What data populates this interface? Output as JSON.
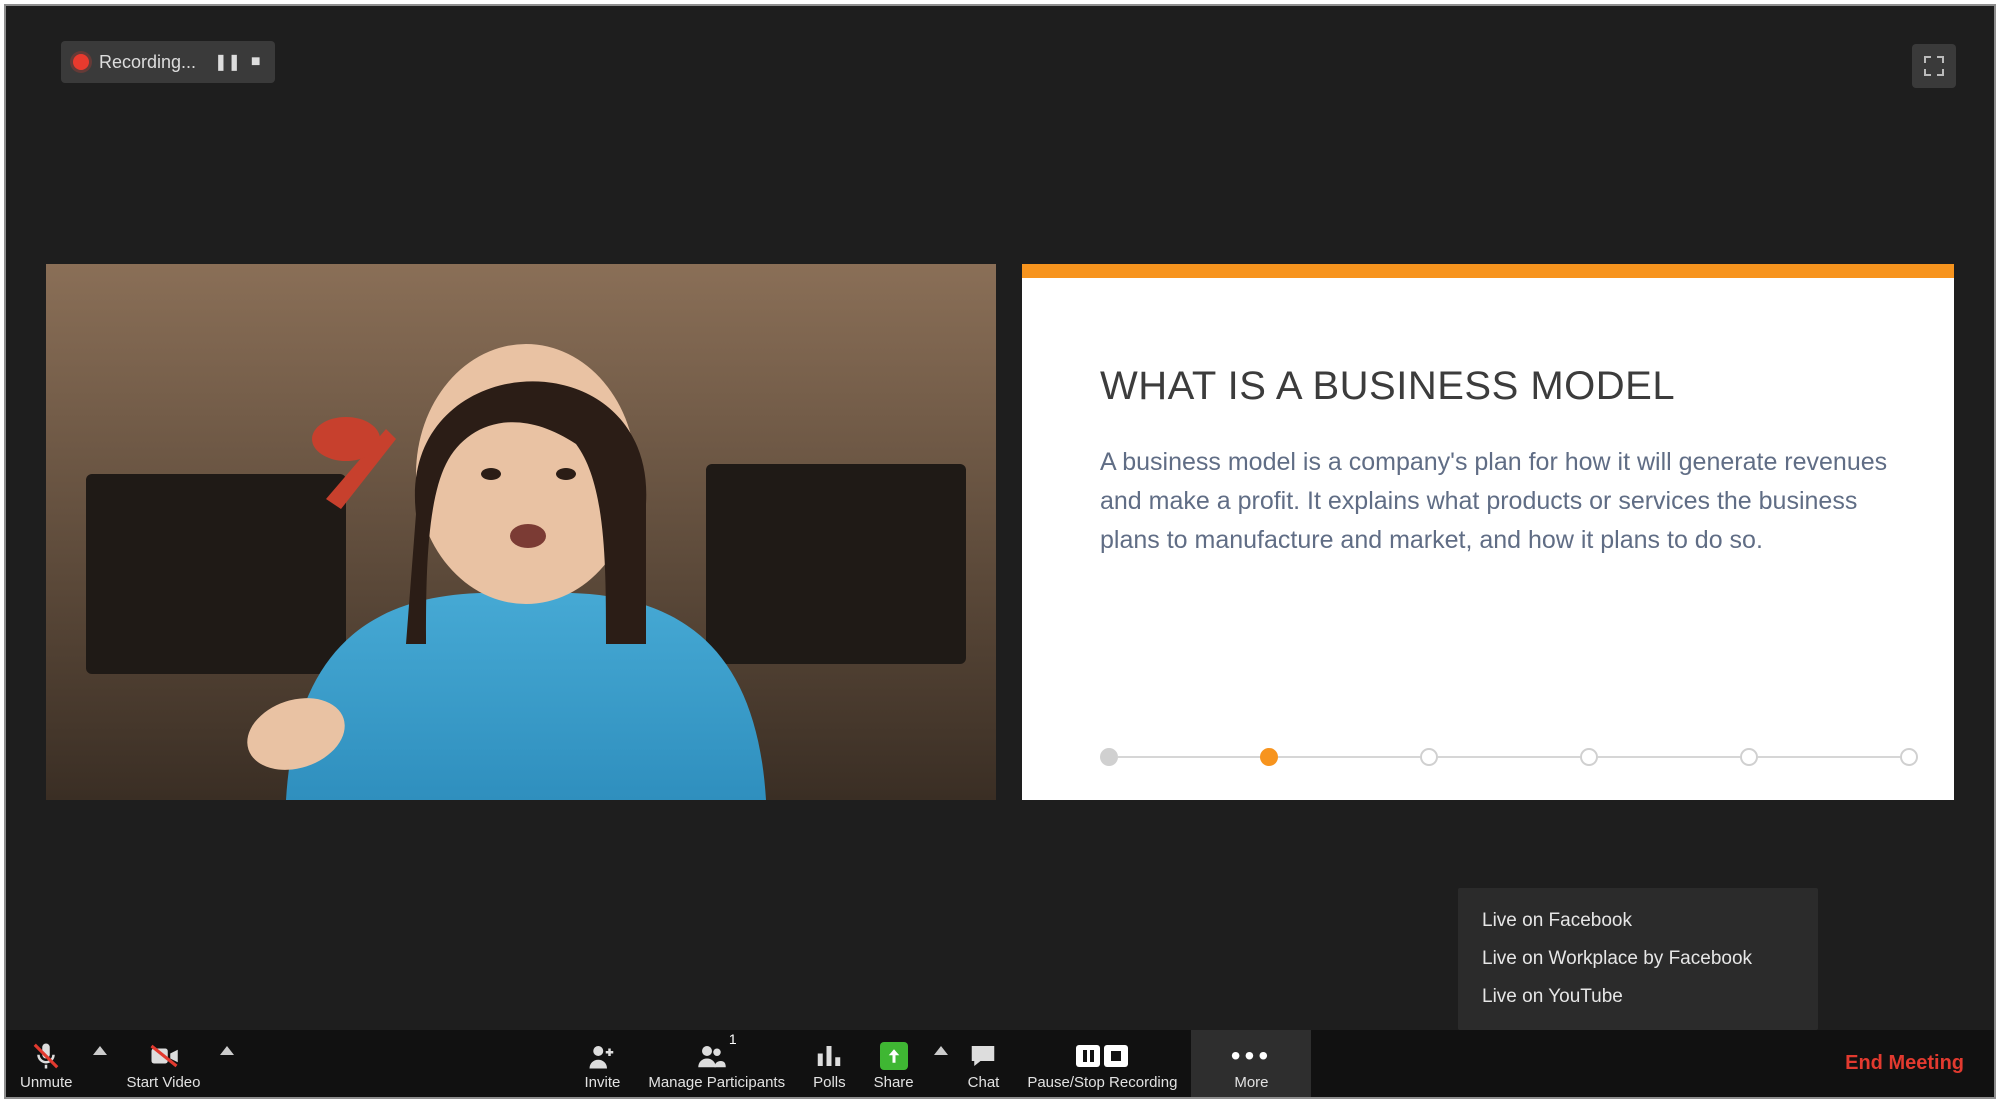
{
  "recording": {
    "label": "Recording...",
    "pause_glyph": "❚❚",
    "stop_glyph": "■"
  },
  "slide": {
    "title": "WHAT IS A BUSINESS MODEL",
    "body": "A business model is a company's plan for how it will generate revenues and make a profit. It explains what products or services the business plans to manufacture and market, and how it plans to do so.",
    "accent_color": "#f7941e"
  },
  "more_menu": {
    "items": [
      "Live on Facebook",
      "Live on Workplace by Facebook",
      "Live on YouTube"
    ]
  },
  "toolbar": {
    "unmute": "Unmute",
    "start_video": "Start Video",
    "invite": "Invite",
    "manage_participants": "Manage Participants",
    "participants_count": "1",
    "polls": "Polls",
    "share": "Share",
    "chat": "Chat",
    "pause_stop_recording": "Pause/Stop Recording",
    "more": "More",
    "end_meeting": "End Meeting"
  }
}
